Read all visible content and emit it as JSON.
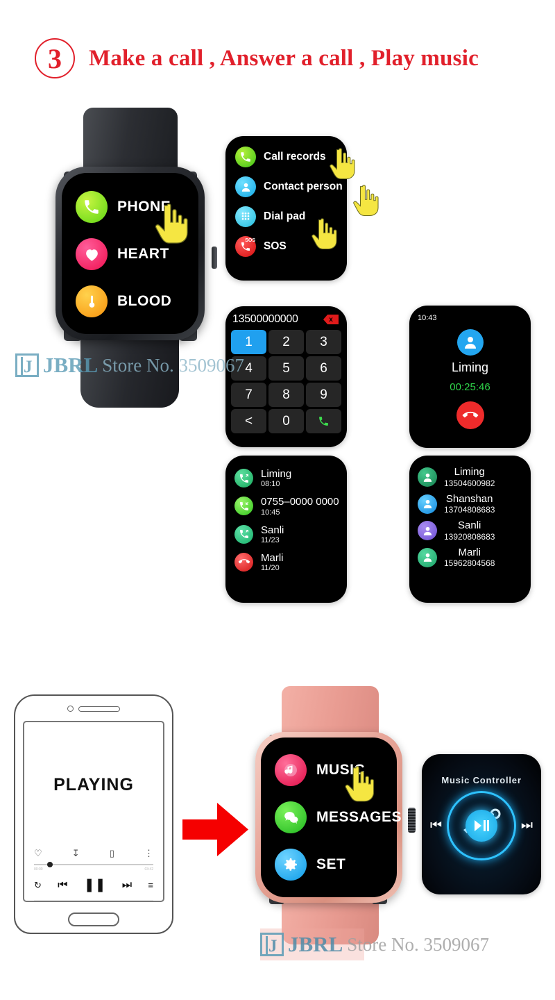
{
  "header": {
    "step": "3",
    "title": "Make a call , Answer a call , Play music",
    "accent": "#e1202b"
  },
  "watch_black": {
    "menu": [
      {
        "label": "PHONE",
        "icon": "phone-icon",
        "color": "#7ee02a"
      },
      {
        "label": "HEART",
        "icon": "heart-icon",
        "color": "#f5265f"
      },
      {
        "label": "BLOOD",
        "icon": "thermometer-icon",
        "color": "#f9a417"
      }
    ]
  },
  "call_menu": {
    "items": [
      {
        "label": "Call records",
        "icon": "phone-icon",
        "color": "#57d023"
      },
      {
        "label": "Contact person",
        "icon": "person-icon",
        "color": "#22bdf0"
      },
      {
        "label": "Dial pad",
        "icon": "keypad-icon",
        "color": "#36c9e8"
      },
      {
        "label": "SOS",
        "icon": "sos-icon",
        "color": "#ef1b1b"
      }
    ]
  },
  "dialpad": {
    "number": "13500000000",
    "delete_label": "x",
    "keys": [
      "1",
      "2",
      "3",
      "4",
      "5",
      "6",
      "7",
      "8",
      "9",
      "<",
      "0",
      "call"
    ],
    "active_key": "1",
    "call_glyph": "✆"
  },
  "call_records": {
    "items": [
      {
        "name": "Liming",
        "time": "08:10",
        "type": "outgoing",
        "color": "#2bbf6a"
      },
      {
        "name": "0755–0000 0000",
        "time": "10:45",
        "type": "incoming",
        "color": "#3ddc2e"
      },
      {
        "name": "Sanli",
        "time": "11/23",
        "type": "outgoing",
        "color": "#2ec47d"
      },
      {
        "name": "Marli",
        "time": "11/20",
        "type": "missed",
        "color": "#e81f1f"
      }
    ]
  },
  "active_call": {
    "clock": "10:43",
    "name": "Liming",
    "duration": "00:25:46",
    "avatar_color": "#23a6f0",
    "end_color": "#ee2b2b"
  },
  "contacts": {
    "items": [
      {
        "name": "Liming",
        "number": "13504600982",
        "color": "#1f9c63"
      },
      {
        "name": "Shanshan",
        "number": "13704808683",
        "color": "#2aa6ee"
      },
      {
        "name": "Sanli",
        "number": "13920808683",
        "color": "#8a6fe0"
      },
      {
        "name": "Marli",
        "number": "15962804568",
        "color": "#2fb97a"
      }
    ]
  },
  "phone": {
    "status": "PLAYING",
    "elapsed": "00:00",
    "remaining": "03:42"
  },
  "watch_pink": {
    "menu": [
      {
        "label": "MUSIC",
        "icon": "music-icon",
        "color": "#f01f4e"
      },
      {
        "label": "MESSAGES",
        "icon": "chat-icon",
        "color": "#2bcc2b"
      },
      {
        "label": "SET",
        "icon": "gear-icon",
        "color": "#1fb0f5"
      }
    ]
  },
  "music_controller": {
    "title": "Music Controller",
    "accent": "#2ec2ff"
  },
  "watermark": {
    "brand": "JBRL",
    "store": "Store No. 3509067"
  }
}
